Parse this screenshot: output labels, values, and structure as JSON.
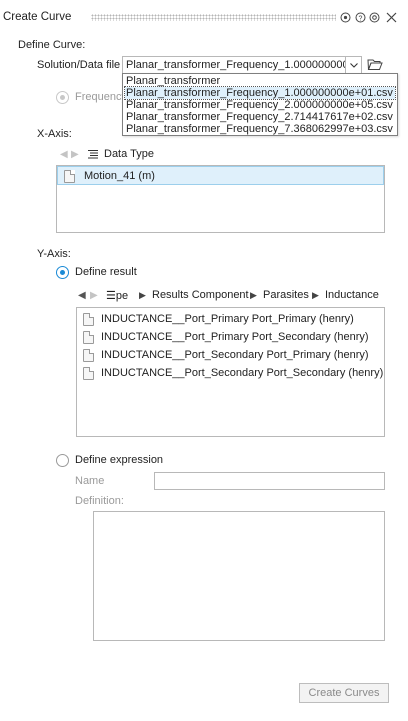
{
  "titlebar": {
    "title": "Create Curve",
    "icons": [
      "settings-icon",
      "help-icon",
      "info-icon",
      "close-icon"
    ]
  },
  "define_curve": {
    "heading": "Define Curve:",
    "source_label": "Solution/Data file",
    "selected_file": "Planar_transformer_Frequency_1.000000000e",
    "dropdown_options": [
      "Planar_transformer",
      "Planar_transformer_Frequency_1.000000000e+01.csv",
      "Planar_transformer_Frequency_2.000000000e+05.csv",
      "Planar_transformer_Frequency_2.714417617e+02.csv",
      "Planar_transformer_Frequency_7.368062997e+03.csv"
    ],
    "highlighted_option_index": 1,
    "frequency_label": "Frequency"
  },
  "x_axis": {
    "heading": "X-Axis:",
    "column_header": "Data Type",
    "items": [
      "Motion_41 (m)"
    ]
  },
  "y_axis": {
    "heading": "Y-Axis:",
    "define_result_label": "Define result",
    "breadcrumb": [
      "Type",
      "Results Component",
      "Parasites",
      "Inductance"
    ],
    "breadcrumb_first_visible": "☰pe",
    "items": [
      "INDUCTANCE__Port_Primary Port_Primary (henry)",
      "INDUCTANCE__Port_Primary Port_Secondary (henry)",
      "INDUCTANCE__Port_Secondary Port_Primary (henry)",
      "INDUCTANCE__Port_Secondary Port_Secondary (henry)"
    ],
    "define_expression_label": "Define expression",
    "name_label": "Name",
    "name_value": "",
    "definition_label": "Definition:",
    "definition_value": ""
  },
  "footer": {
    "create_button": "Create Curves"
  },
  "colors": {
    "accent": "#1a8ad6",
    "selection": "#dff0fb",
    "selection_border": "#9ccfec",
    "border": "#b8b8b8",
    "disabled_text": "#9a9a9a"
  }
}
